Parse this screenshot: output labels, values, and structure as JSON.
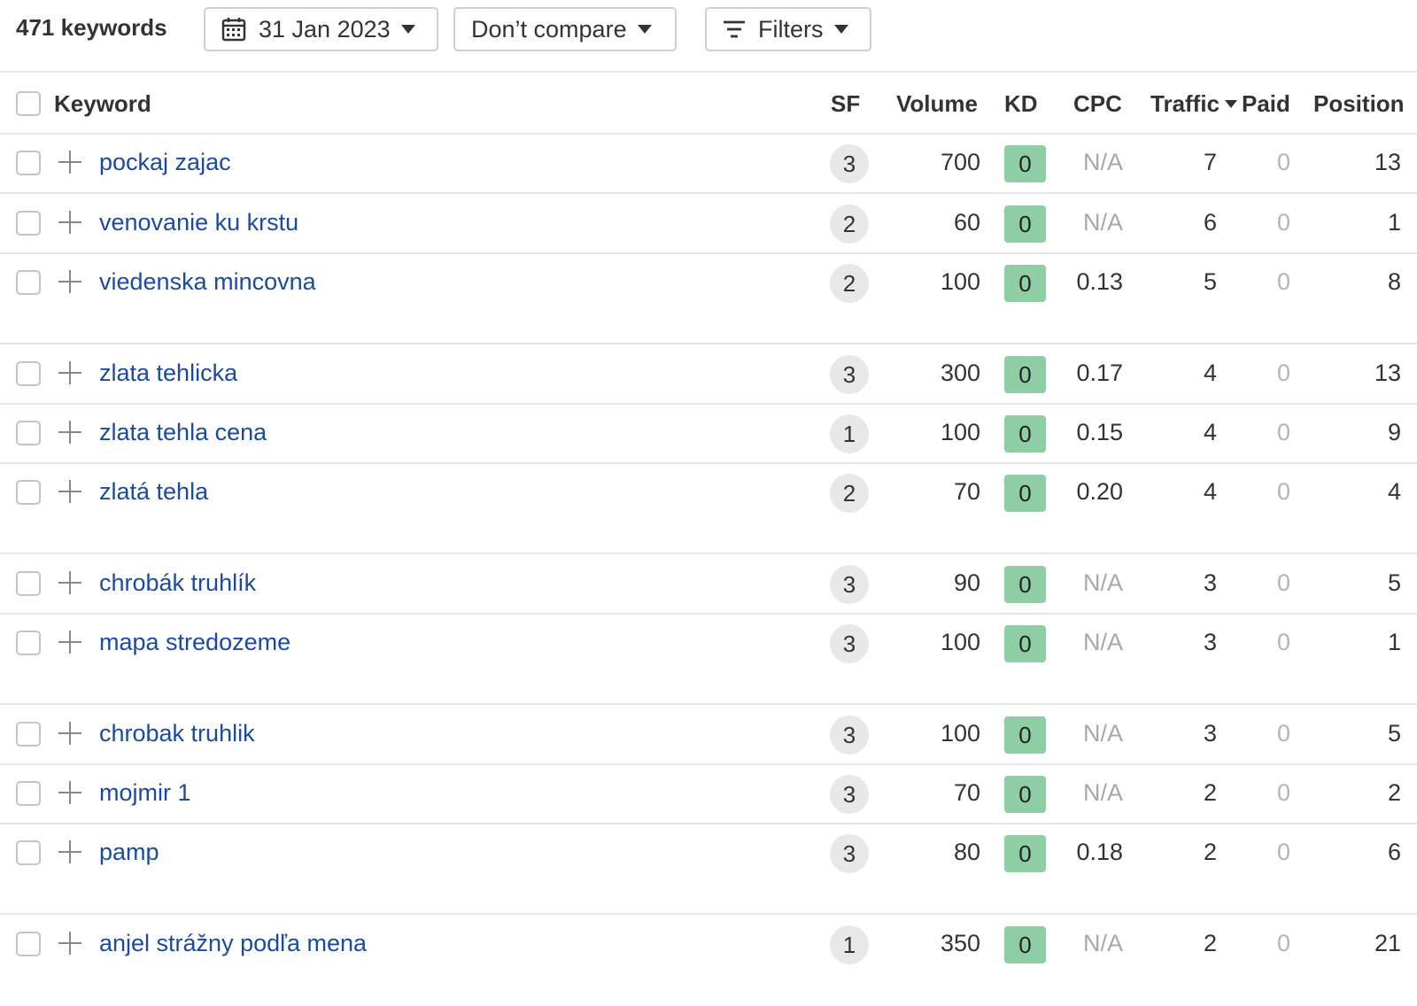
{
  "toolbar": {
    "keyword_count": "471 keywords",
    "date_label": "31 Jan 2023",
    "compare_label": "Don’t compare",
    "filters_label": "Filters"
  },
  "columns": {
    "keyword": "Keyword",
    "sf": "SF",
    "volume": "Volume",
    "kd": "KD",
    "cpc": "CPC",
    "traffic": "Traffic",
    "paid": "Paid",
    "position": "Position"
  },
  "colors": {
    "link": "#1b4aa0",
    "kd_badge": "#8fcea5",
    "sf_badge": "#e8e8e8",
    "muted": "#a8a8a8"
  },
  "rows": [
    {
      "keyword": "pockaj zajac",
      "sf": "3",
      "volume": "700",
      "kd": "0",
      "cpc": "N/A",
      "traffic": "7",
      "paid": "0",
      "position": "13"
    },
    {
      "keyword": "venovanie ku krstu",
      "sf": "2",
      "volume": "60",
      "kd": "0",
      "cpc": "N/A",
      "traffic": "6",
      "paid": "0",
      "position": "1"
    },
    {
      "keyword": "viedenska mincovna",
      "sf": "2",
      "volume": "100",
      "kd": "0",
      "cpc": "0.13",
      "traffic": "5",
      "paid": "0",
      "position": "8"
    },
    {
      "keyword": "zlata tehlicka",
      "sf": "3",
      "volume": "300",
      "kd": "0",
      "cpc": "0.17",
      "traffic": "4",
      "paid": "0",
      "position": "13"
    },
    {
      "keyword": "zlata tehla cena",
      "sf": "1",
      "volume": "100",
      "kd": "0",
      "cpc": "0.15",
      "traffic": "4",
      "paid": "0",
      "position": "9"
    },
    {
      "keyword": "zlatá tehla",
      "sf": "2",
      "volume": "70",
      "kd": "0",
      "cpc": "0.20",
      "traffic": "4",
      "paid": "0",
      "position": "4"
    },
    {
      "keyword": "chrobák truhlík",
      "sf": "3",
      "volume": "90",
      "kd": "0",
      "cpc": "N/A",
      "traffic": "3",
      "paid": "0",
      "position": "5"
    },
    {
      "keyword": "mapa stredozeme",
      "sf": "3",
      "volume": "100",
      "kd": "0",
      "cpc": "N/A",
      "traffic": "3",
      "paid": "0",
      "position": "1"
    },
    {
      "keyword": "chrobak truhlik",
      "sf": "3",
      "volume": "100",
      "kd": "0",
      "cpc": "N/A",
      "traffic": "3",
      "paid": "0",
      "position": "5"
    },
    {
      "keyword": "mojmir 1",
      "sf": "3",
      "volume": "70",
      "kd": "0",
      "cpc": "N/A",
      "traffic": "2",
      "paid": "0",
      "position": "2"
    },
    {
      "keyword": "pamp",
      "sf": "3",
      "volume": "80",
      "kd": "0",
      "cpc": "0.18",
      "traffic": "2",
      "paid": "0",
      "position": "6"
    },
    {
      "keyword": "anjel strážny podľa mena",
      "sf": "1",
      "volume": "350",
      "kd": "0",
      "cpc": "N/A",
      "traffic": "2",
      "paid": "0",
      "position": "21"
    }
  ]
}
